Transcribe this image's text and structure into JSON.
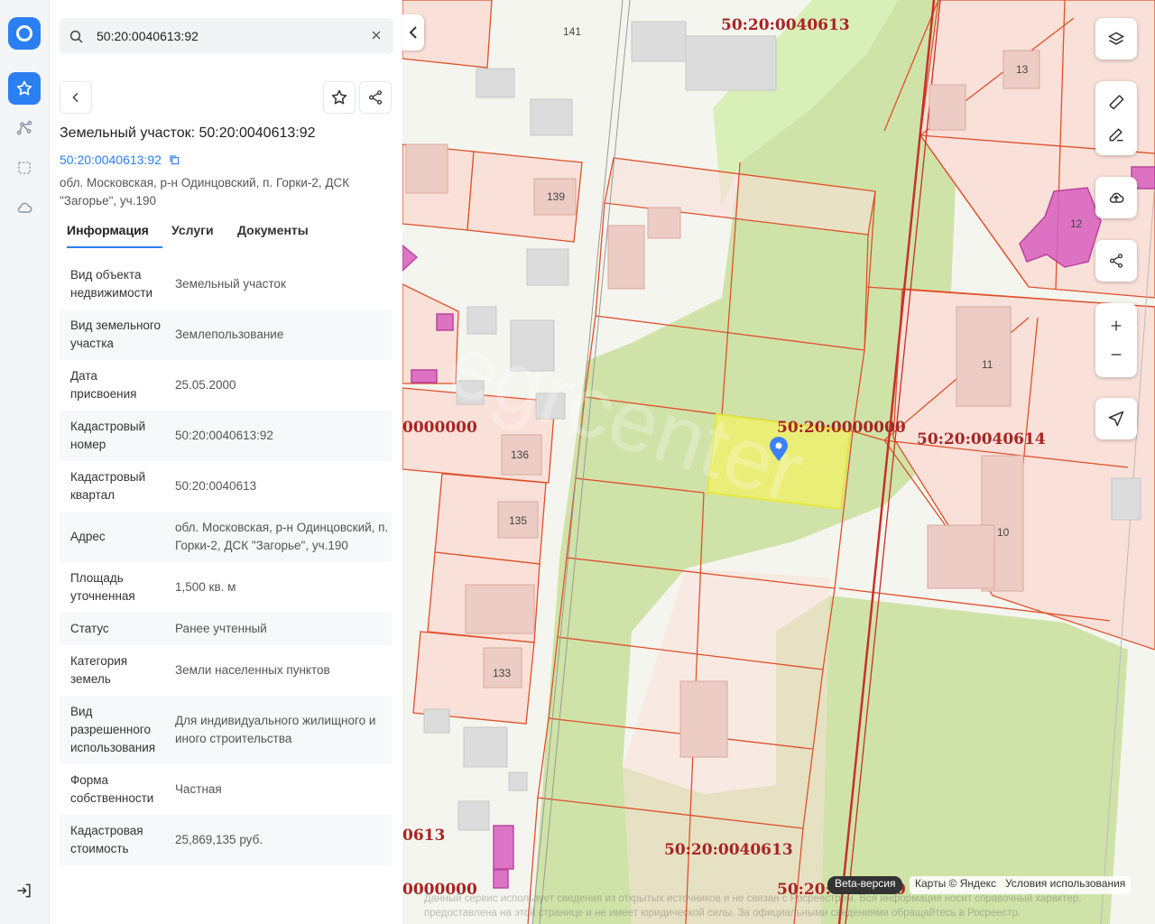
{
  "search": {
    "query": "50:20:0040613:92"
  },
  "panel": {
    "title": "Земельный участок: 50:20:0040613:92",
    "cad_link": "50:20:0040613:92",
    "address": "обл. Московская, р-н Одинцовский, п. Горки-2, ДСК \"Загорье\", уч.190",
    "tabs": [
      {
        "label": "Информация"
      },
      {
        "label": "Услуги"
      },
      {
        "label": "Документы"
      }
    ],
    "rows": [
      {
        "key": "Вид объекта недвижимости",
        "value": "Земельный участок"
      },
      {
        "key": "Вид земельного участка",
        "value": "Землепользование"
      },
      {
        "key": "Дата присвоения",
        "value": "25.05.2000"
      },
      {
        "key": "Кадастровый номер",
        "value": "50:20:0040613:92"
      },
      {
        "key": "Кадастровый квартал",
        "value": "50:20:0040613"
      },
      {
        "key": "Адрес",
        "value": "обл. Московская, р-н Одинцовский, п. Горки-2, ДСК \"Загорье\", уч.190"
      },
      {
        "key": "Площадь уточненная",
        "value": "1,500 кв. м"
      },
      {
        "key": "Статус",
        "value": "Ранее учтенный"
      },
      {
        "key": "Категория земель",
        "value": "Земли населенных пунктов"
      },
      {
        "key": "Вид разрешенного использования",
        "value": "Для индивидуального жилищного и иного строительства"
      },
      {
        "key": "Форма собственности",
        "value": "Частная"
      },
      {
        "key": "Кадастровая стоимость",
        "value": "25,869,135 руб."
      }
    ]
  },
  "map": {
    "cad_labels": [
      "50:20:0040613",
      "50:20:0000000",
      "50:20:0040614",
      "50:20:0040613",
      "50:20:0000000",
      "0000000",
      "0613",
      "0000000"
    ],
    "house_numbers": [
      "141",
      "13",
      "139",
      "12",
      "11",
      "136",
      "135",
      "10",
      "133"
    ],
    "beta": "Beta-версия",
    "attribution": "Карты © Яндекс",
    "terms": "Условия использования",
    "disclaimer": "Данный сервис использует сведения из открытых источников и не связан с Росреестром. Вся информация носит справочный характер, предоставлена на этой странице и не имеет юридической силы. За официальными сведениями обращайтесь в Росреестр."
  },
  "colors": {
    "accent": "#2b7ff0",
    "parcel_line": "#e0502a",
    "selected_fill": "#f0f06a",
    "green": "#cfe3a8",
    "pink": "#f9e0d8",
    "magenta": "#d95fc0"
  }
}
